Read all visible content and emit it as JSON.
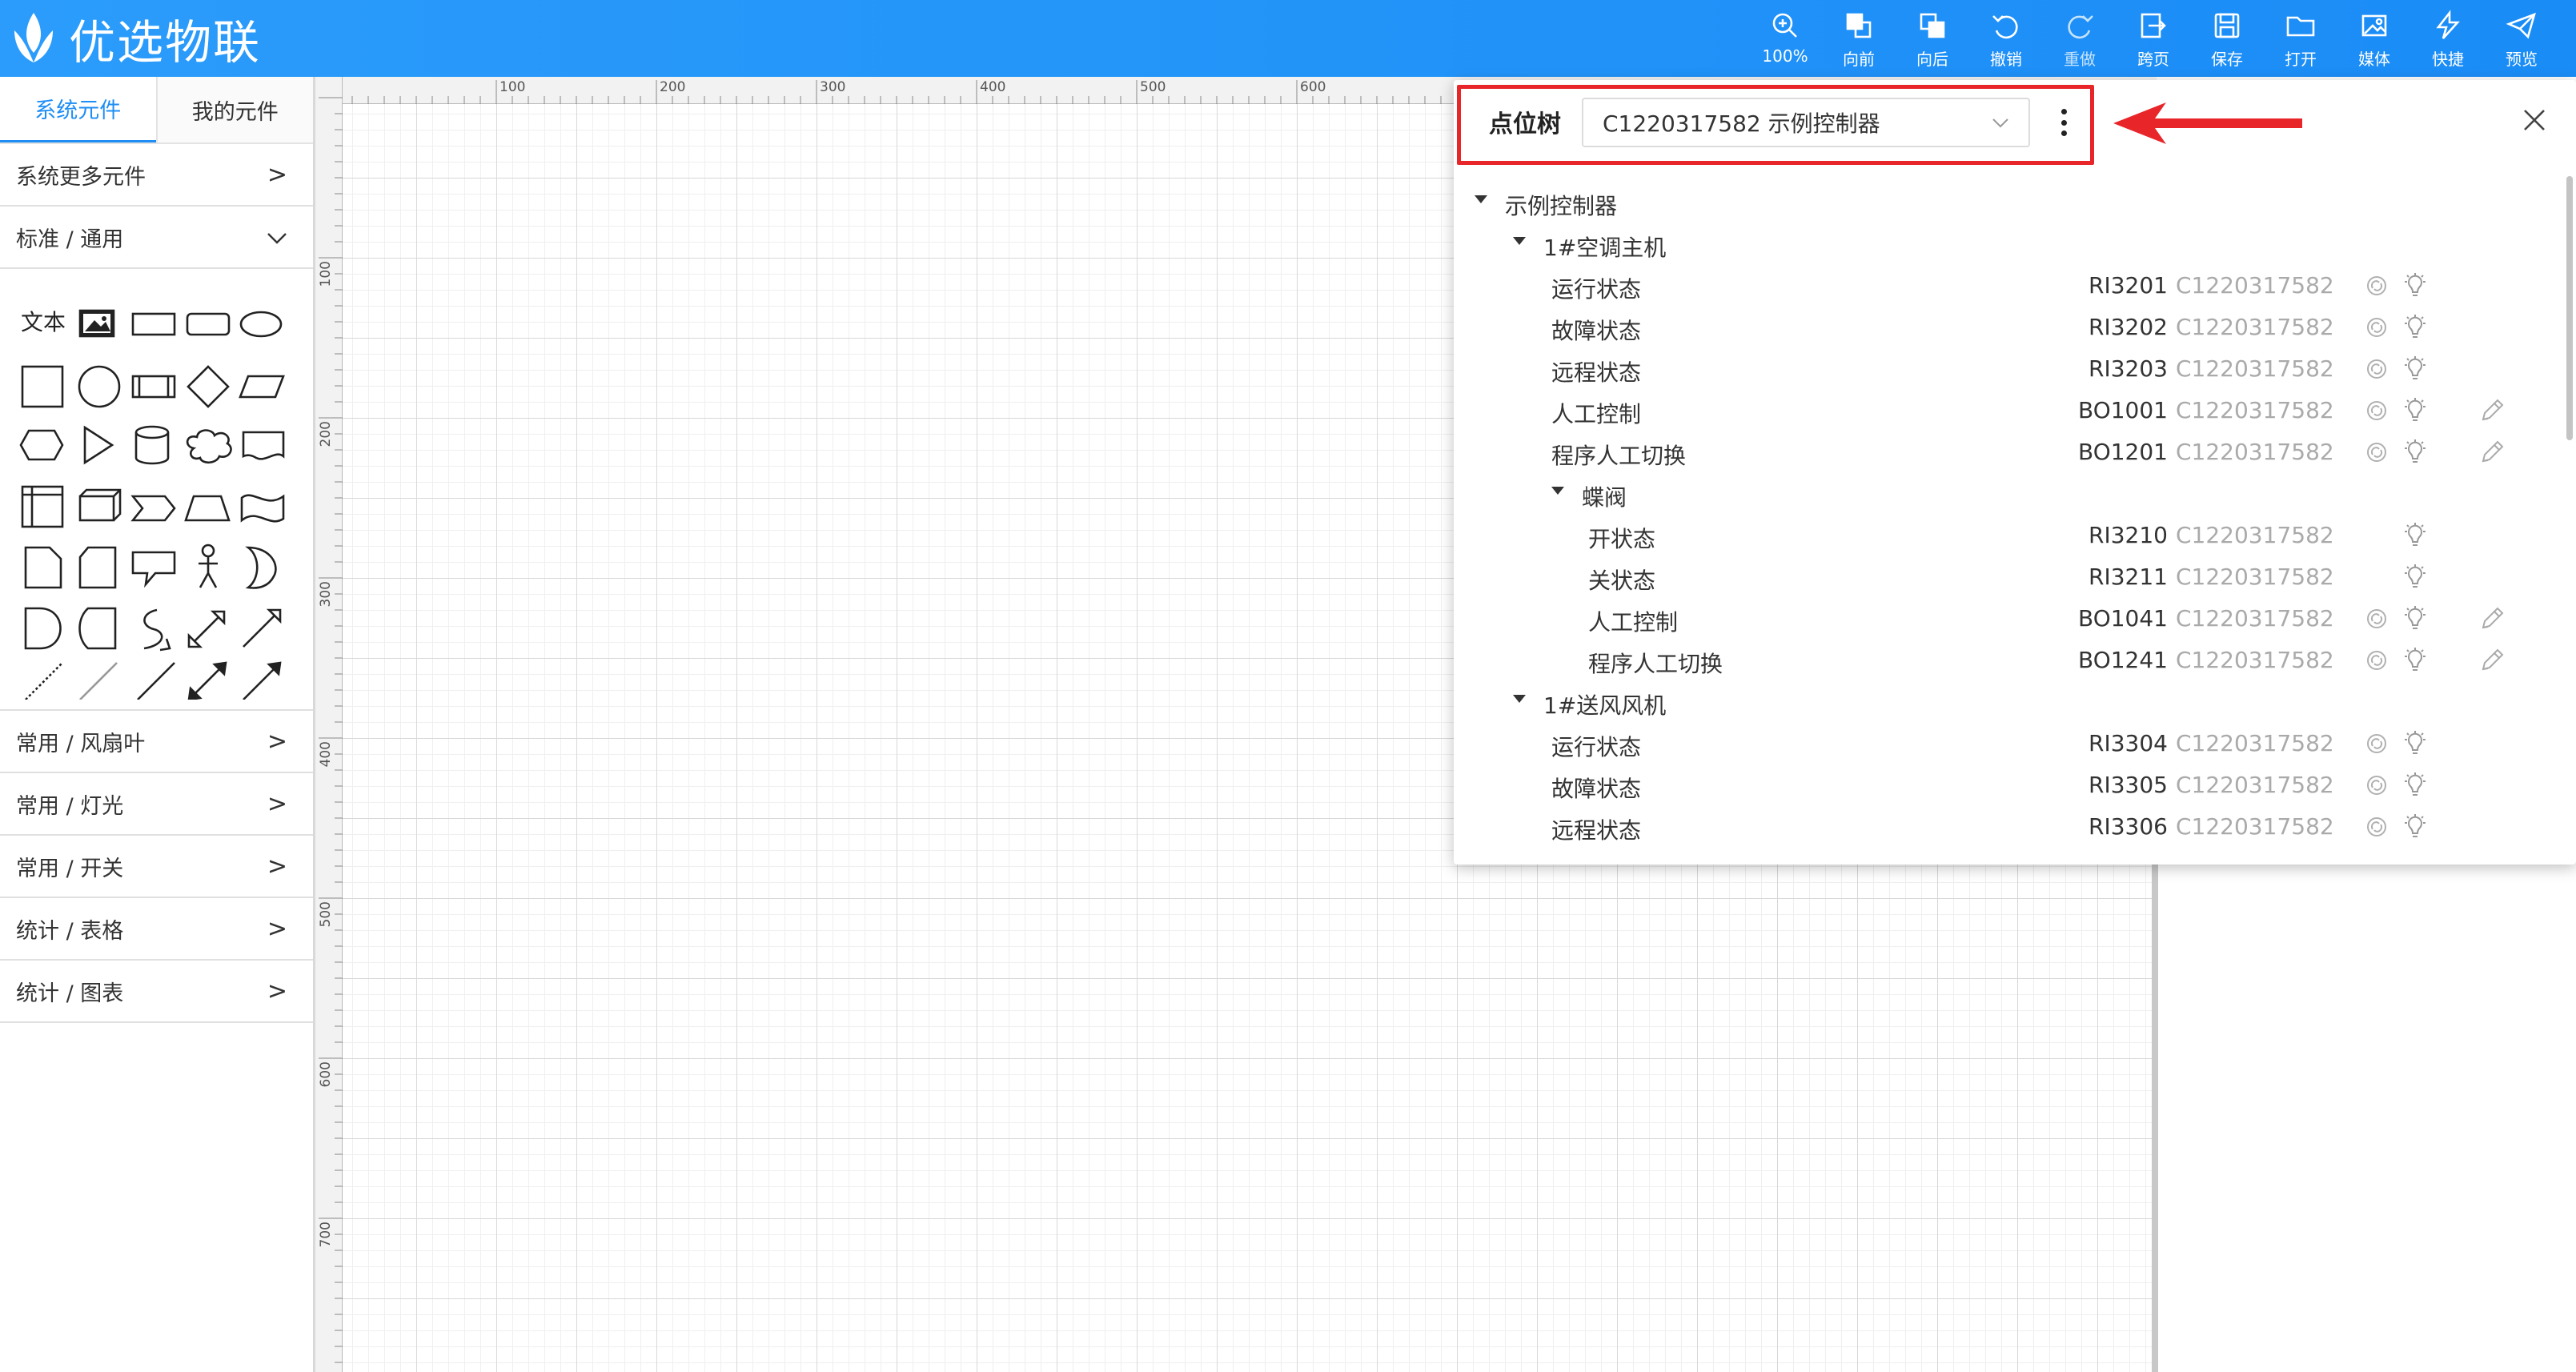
{
  "app": {
    "title": "优选物联"
  },
  "toolbar": [
    {
      "name": "zoom",
      "label": "100%"
    },
    {
      "name": "forward",
      "label": "向前"
    },
    {
      "name": "backward",
      "label": "向后"
    },
    {
      "name": "undo",
      "label": "撤销"
    },
    {
      "name": "redo",
      "label": "重做"
    },
    {
      "name": "cross-page",
      "label": "跨页"
    },
    {
      "name": "save",
      "label": "保存"
    },
    {
      "name": "open",
      "label": "打开"
    },
    {
      "name": "media",
      "label": "媒体"
    },
    {
      "name": "shortcut",
      "label": "快捷"
    },
    {
      "name": "preview",
      "label": "预览"
    }
  ],
  "sidebar": {
    "tabs": [
      "系统元件",
      "我的元件"
    ],
    "more": "系统更多元件",
    "standard": "标准 / 通用",
    "text_shape": "文本",
    "sections": [
      "常用 / 风扇叶",
      "常用 / 灯光",
      "常用 / 开关",
      "统计 / 表格",
      "统计 / 图表"
    ]
  },
  "ruler": {
    "h": [
      "100",
      "200",
      "300",
      "400",
      "500",
      "600"
    ],
    "v": [
      "100",
      "200",
      "300",
      "400",
      "500",
      "600",
      "700"
    ]
  },
  "panel": {
    "title": "点位树",
    "selected": "C1220317582 示例控制器",
    "tree": [
      {
        "level": 0,
        "label": "示例控制器",
        "expand": true
      },
      {
        "level": 1,
        "label": "1#空调主机",
        "expand": true
      },
      {
        "level": 2,
        "label": "运行状态",
        "code": "RI3201",
        "device": "C1220317582",
        "icons": [
          "link",
          "bulb"
        ]
      },
      {
        "level": 2,
        "label": "故障状态",
        "code": "RI3202",
        "device": "C1220317582",
        "icons": [
          "link",
          "bulb"
        ]
      },
      {
        "level": 2,
        "label": "远程状态",
        "code": "RI3203",
        "device": "C1220317582",
        "icons": [
          "link",
          "bulb"
        ]
      },
      {
        "level": 2,
        "label": "人工控制",
        "code": "BO1001",
        "device": "C1220317582",
        "icons": [
          "link",
          "bulb",
          "edit"
        ]
      },
      {
        "level": 2,
        "label": "程序人工切换",
        "code": "BO1201",
        "device": "C1220317582",
        "icons": [
          "link",
          "bulb",
          "edit"
        ]
      },
      {
        "level": 2,
        "label": "蝶阀",
        "expand": true
      },
      {
        "level": 3,
        "label": "开状态",
        "code": "RI3210",
        "device": "C1220317582",
        "icons": [
          "bulb"
        ]
      },
      {
        "level": 3,
        "label": "关状态",
        "code": "RI3211",
        "device": "C1220317582",
        "icons": [
          "bulb"
        ]
      },
      {
        "level": 3,
        "label": "人工控制",
        "code": "BO1041",
        "device": "C1220317582",
        "icons": [
          "link",
          "bulb",
          "edit"
        ]
      },
      {
        "level": 3,
        "label": "程序人工切换",
        "code": "BO1241",
        "device": "C1220317582",
        "icons": [
          "link",
          "bulb",
          "edit"
        ]
      },
      {
        "level": 1,
        "label": "1#送风风机",
        "expand": true
      },
      {
        "level": 2,
        "label": "运行状态",
        "code": "RI3304",
        "device": "C1220317582",
        "icons": [
          "link",
          "bulb"
        ]
      },
      {
        "level": 2,
        "label": "故障状态",
        "code": "RI3305",
        "device": "C1220317582",
        "icons": [
          "link",
          "bulb"
        ]
      },
      {
        "level": 2,
        "label": "远程状态",
        "code": "RI3306",
        "device": "C1220317582",
        "icons": [
          "link",
          "bulb"
        ]
      }
    ]
  },
  "colors": {
    "header": "#1a8cf6",
    "accent": "#1e8ef5",
    "highlight": "#e8262a"
  }
}
